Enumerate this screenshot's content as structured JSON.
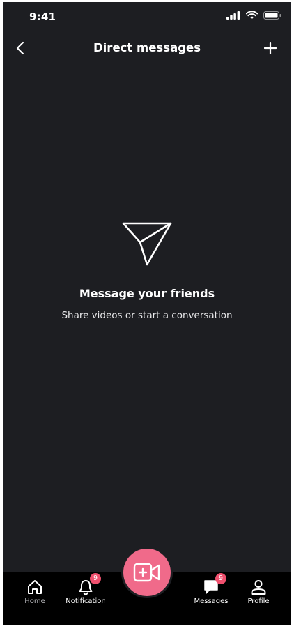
{
  "status_bar": {
    "time": "9:41"
  },
  "header": {
    "title": "Direct messages"
  },
  "empty_state": {
    "title": "Message your friends",
    "subtitle": "Share videos or start a conversation"
  },
  "tabs": [
    {
      "label": "Home",
      "icon": "home-icon"
    },
    {
      "label": "Notification",
      "icon": "bell-icon",
      "badge": "9"
    },
    {
      "label": "Messages",
      "icon": "message-icon",
      "badge": "9"
    },
    {
      "label": "Profile",
      "icon": "profile-icon"
    }
  ],
  "record_button": {
    "icon": "video-plus-icon"
  },
  "colors": {
    "background": "#1d1e22",
    "accent": "#f06a8a",
    "badge": "#f0506e",
    "tab_bar": "#000000"
  }
}
